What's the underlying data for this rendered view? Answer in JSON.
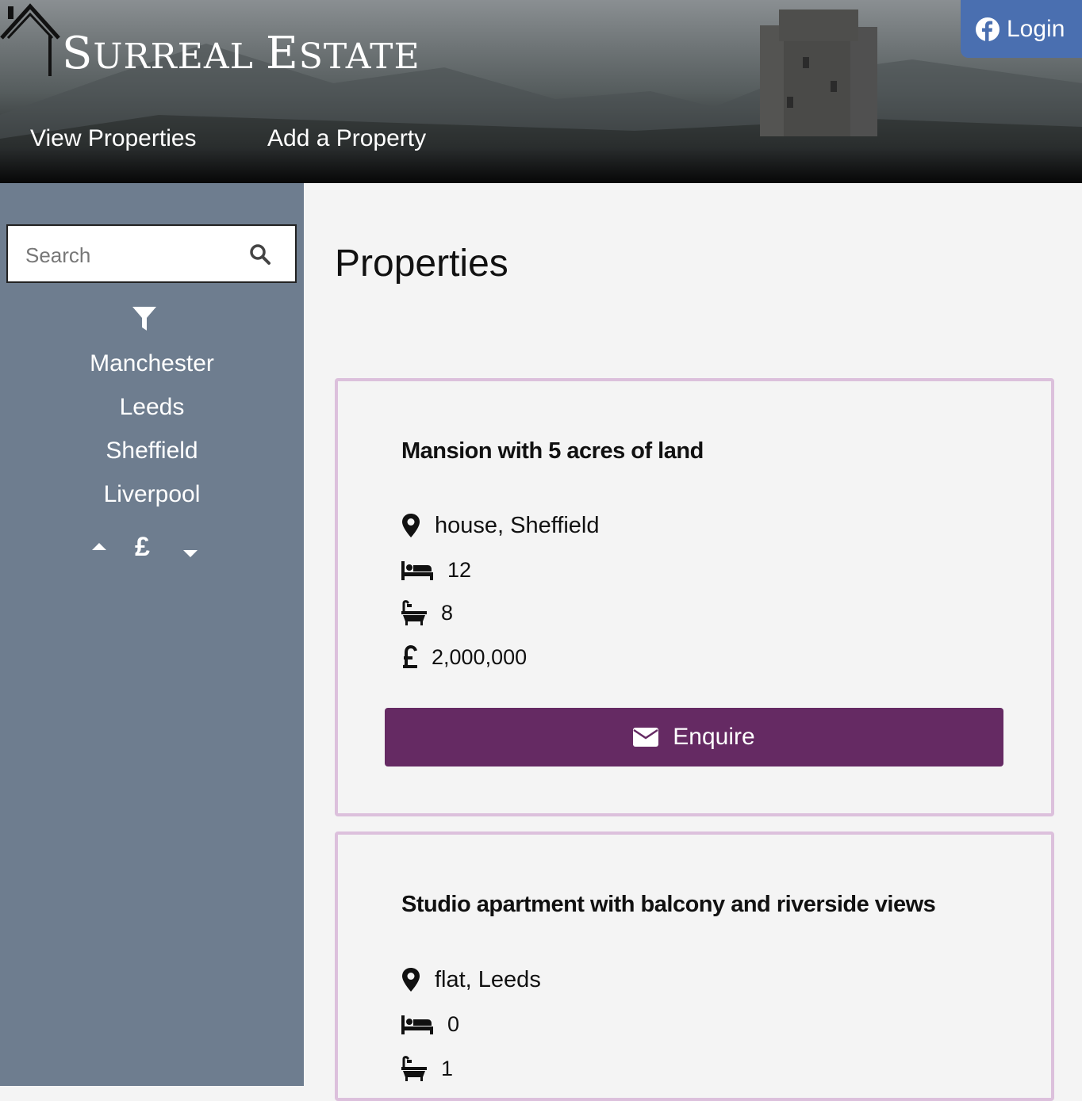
{
  "header": {
    "brand_first": "S",
    "brand_rest": "URREAL ",
    "brand_second": "E",
    "brand_second_rest": "STATE",
    "nav": [
      {
        "label": "View Properties"
      },
      {
        "label": "Add a Property"
      }
    ],
    "login_label": "Login",
    "login_icon": "facebook-icon"
  },
  "sidebar": {
    "search": {
      "placeholder": "Search",
      "value": ""
    },
    "filter_icon": "filter-icon",
    "cities": [
      "Manchester",
      "Leeds",
      "Sheffield",
      "Liverpool"
    ],
    "price_sort": {
      "symbol": "£",
      "up_icon": "caret-up-icon",
      "down_icon": "caret-down-icon"
    }
  },
  "main": {
    "title": "Properties",
    "properties": [
      {
        "title": "Mansion with 5 acres of land",
        "location": "house, Sheffield",
        "bedrooms": "12",
        "bathrooms": "8",
        "price": "2,000,000",
        "enquire_label": "Enquire"
      },
      {
        "title": "Studio apartment with balcony and riverside views",
        "location": "flat, Leeds",
        "bedrooms": "0",
        "bathrooms": "1"
      }
    ]
  },
  "colors": {
    "sidebar_bg": "#6e7d8f",
    "login_bg": "#4a6fb0",
    "enquire_bg": "#652a63",
    "card_border": "#dcc0dc",
    "page_bg": "#f4f4f4"
  }
}
